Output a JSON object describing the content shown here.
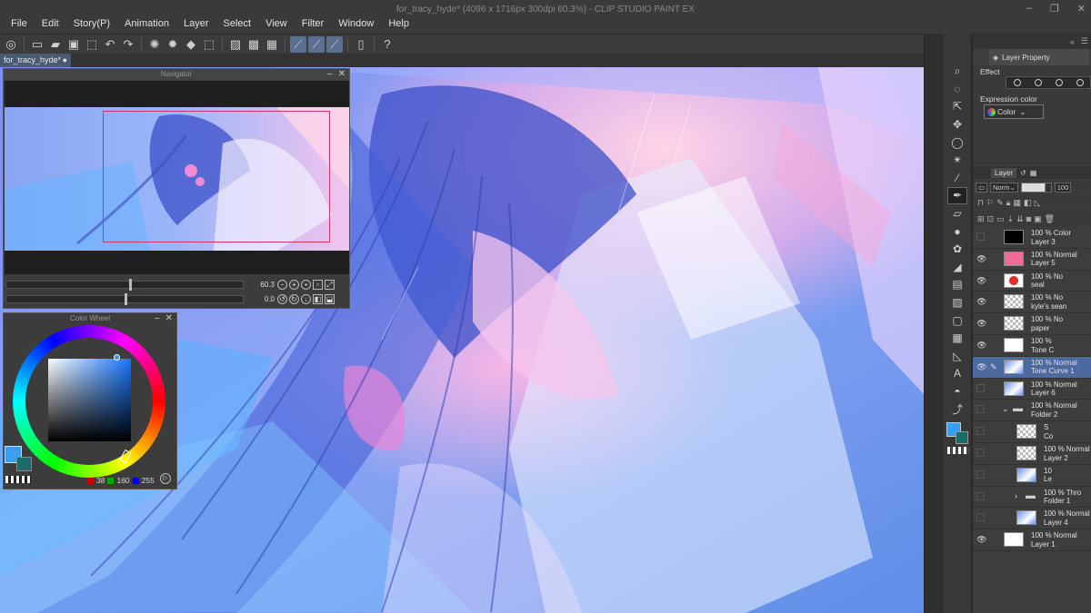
{
  "window": {
    "title": "for_tracy_hyde* (4096 x 1716px 300dpi 60.3%) - CLIP STUDIO PAINT EX",
    "controls": [
      "–",
      "❐",
      "✕"
    ]
  },
  "menu": [
    "File",
    "Edit",
    "Story(P)",
    "Animation",
    "Layer",
    "Select",
    "View",
    "Filter",
    "Window",
    "Help"
  ],
  "document_tab": {
    "label": "for_tracy_hyde*",
    "close": "●"
  },
  "navigator": {
    "title": "Navigator",
    "zoom_value": "60.3",
    "rotation_value": "0.0",
    "zoom_level": 0.52,
    "rotation_level": 0.5
  },
  "color_wheel": {
    "title": "Color Wheel",
    "rgb": {
      "r": "38",
      "g": "160",
      "b": "255"
    },
    "colors": {
      "main": "#3a9ef0",
      "sub": "#1c6b6b"
    }
  },
  "layer_property": {
    "tab": "Layer Property",
    "effect_label": "Effect",
    "expression_label": "Expression color",
    "expression_value": "Color"
  },
  "layer_panel": {
    "tab": "Layer",
    "blend_mode": "Norm",
    "opacity": "100",
    "layers": [
      {
        "mode": "100 % Color",
        "name": "Layer 3",
        "visible": false,
        "indent": 0,
        "thumb": "black"
      },
      {
        "mode": "100 % Normal",
        "name": "Layer 5",
        "visible": true,
        "indent": 0,
        "thumb": "pink"
      },
      {
        "mode": "100 % No",
        "name": "seal",
        "visible": true,
        "indent": 0,
        "thumb": "seal"
      },
      {
        "mode": "100 % No",
        "name": "kyle's sean",
        "visible": true,
        "indent": 0,
        "thumb": "checker"
      },
      {
        "mode": "100 % No",
        "name": "paper",
        "visible": true,
        "indent": 0,
        "thumb": "checker"
      },
      {
        "mode": "100 %",
        "name": "Tone C",
        "visible": true,
        "indent": 0,
        "thumb": "curve"
      },
      {
        "mode": "100 % Normal",
        "name": "Tone Curve 1",
        "visible": true,
        "indent": 0,
        "thumb": "blue",
        "selected": true
      },
      {
        "mode": "100 % Normal",
        "name": "Layer 6",
        "visible": false,
        "indent": 0,
        "thumb": "blue"
      },
      {
        "mode": "100 % Normal",
        "name": "Folder 2",
        "visible": false,
        "indent": 0,
        "thumb": "folder"
      },
      {
        "mode": "S",
        "name": "Co",
        "visible": false,
        "indent": 1,
        "thumb": "checker"
      },
      {
        "mode": "100 % Normal",
        "name": "Layer 2",
        "visible": false,
        "indent": 1,
        "thumb": "checker"
      },
      {
        "mode": "10",
        "name": "Le",
        "visible": false,
        "indent": 1,
        "thumb": "blue"
      },
      {
        "mode": "100 % Thro",
        "name": "Folder 1",
        "visible": false,
        "indent": 1,
        "thumb": "folder"
      },
      {
        "mode": "100 % Normal",
        "name": "Layer 4",
        "visible": false,
        "indent": 1,
        "thumb": "blue"
      },
      {
        "mode": "100 % Normal",
        "name": "Layer 1",
        "visible": true,
        "indent": 0,
        "thumb": "white"
      }
    ]
  }
}
